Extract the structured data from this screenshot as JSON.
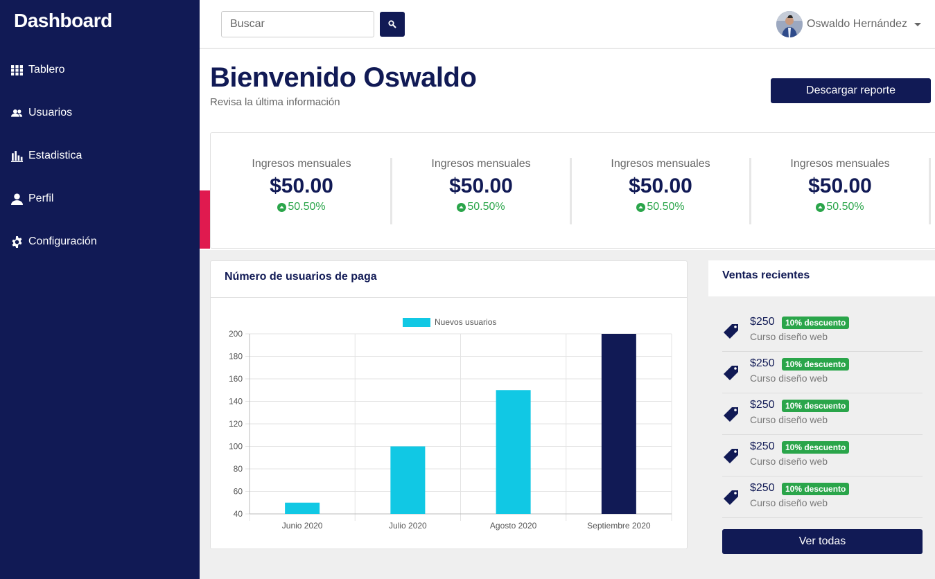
{
  "sidebar": {
    "brand": "Dashboard",
    "items": [
      {
        "label": "Tablero",
        "icon": "grid-icon"
      },
      {
        "label": "Usuarios",
        "icon": "users-icon"
      },
      {
        "label": "Estadistica",
        "icon": "bar-chart-icon"
      },
      {
        "label": "Perfil",
        "icon": "user-icon"
      },
      {
        "label": "Configuración",
        "icon": "gear-icon"
      }
    ]
  },
  "topbar": {
    "search_placeholder": "Buscar",
    "user_name": "Oswaldo Hernández"
  },
  "header": {
    "title": "Bienvenido Oswaldo",
    "subtitle": "Revisa la última información",
    "report_button": "Descargar reporte"
  },
  "stats": [
    {
      "label": "Ingresos mensuales",
      "value": "$50.00",
      "change": "50.50%"
    },
    {
      "label": "Ingresos mensuales",
      "value": "$50.00",
      "change": "50.50%"
    },
    {
      "label": "Ingresos mensuales",
      "value": "$50.00",
      "change": "50.50%"
    },
    {
      "label": "Ingresos mensuales",
      "value": "$50.00",
      "change": "50.50%"
    }
  ],
  "chart_card": {
    "title": "Número de usuarios de paga"
  },
  "chart_data": {
    "type": "bar",
    "categories": [
      "Junio 2020",
      "Julio 2020",
      "Agosto 2020",
      "Septiembre 2020"
    ],
    "series": [
      {
        "name": "Nuevos usuarios",
        "values": [
          50,
          100,
          150,
          200
        ]
      }
    ],
    "bar_colors": [
      "#11c8e4",
      "#11c8e4",
      "#11c8e4",
      "#111a55"
    ],
    "legend_color": "#11c8e4",
    "ylim": [
      40,
      200
    ],
    "yticks": [
      40,
      60,
      80,
      100,
      120,
      140,
      160,
      180,
      200
    ],
    "grid": true,
    "legend": "top-center"
  },
  "sales": {
    "title": "Ventas recientes",
    "items": [
      {
        "price": "$250",
        "badge": "10% descuento",
        "course": "Curso diseño web"
      },
      {
        "price": "$250",
        "badge": "10% descuento",
        "course": "Curso diseño web"
      },
      {
        "price": "$250",
        "badge": "10% descuento",
        "course": "Curso diseño web"
      },
      {
        "price": "$250",
        "badge": "10% descuento",
        "course": "Curso diseño web"
      },
      {
        "price": "$250",
        "badge": "10% descuento",
        "course": "Curso diseño web"
      }
    ],
    "view_all": "Ver todas"
  },
  "colors": {
    "primary": "#111a55",
    "accent_red": "#e01a4f",
    "success": "#2aa54a",
    "chart_bar": "#11c8e4"
  }
}
